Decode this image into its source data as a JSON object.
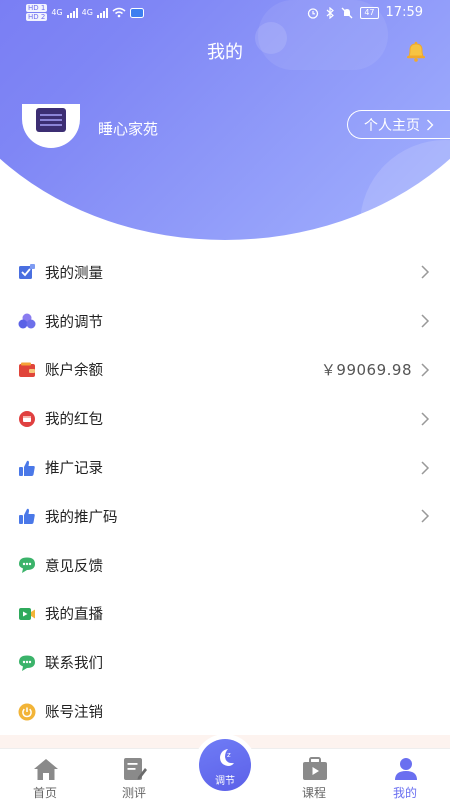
{
  "status_bar": {
    "hd1": "HD 1",
    "hd2": "HD 2",
    "net1": "4G",
    "net2": "4G",
    "battery": "47",
    "time": "17:59"
  },
  "header": {
    "title": "我的",
    "nickname": "睡心家苑",
    "homepage_label": "个人主页"
  },
  "menu": [
    {
      "label": "我的测量",
      "value": "",
      "icon": "measure-icon",
      "color": "#4a6fe0"
    },
    {
      "label": "我的调节",
      "value": "",
      "icon": "adjust-icon",
      "color": "#6b6be0"
    },
    {
      "label": "账户余额",
      "value": "￥99069.98",
      "icon": "wallet-icon",
      "color": "#e0453a"
    },
    {
      "label": "我的红包",
      "value": "",
      "icon": "red-packet-icon",
      "color": "#e04040"
    },
    {
      "label": "推广记录",
      "value": "",
      "icon": "thumb-up-icon",
      "color": "#4a78e8"
    },
    {
      "label": "我的推广码",
      "value": "",
      "icon": "thumb-up-icon",
      "color": "#4a78e8"
    },
    {
      "label": "意见反馈",
      "value": "",
      "icon": "chat-icon",
      "color": "#3bb36a"
    },
    {
      "label": "我的直播",
      "value": "",
      "icon": "video-icon",
      "color": "#2faa5c"
    },
    {
      "label": "联系我们",
      "value": "",
      "icon": "chat-icon",
      "color": "#3bb36a"
    },
    {
      "label": "账号注销",
      "value": "",
      "icon": "power-icon",
      "color": "#f2b437"
    }
  ],
  "tabbar": {
    "home": "首页",
    "evaluate": "测评",
    "adjust": "调节",
    "course": "课程",
    "mine": "我的"
  },
  "colors": {
    "accent": "#6a6ff0",
    "header_gradient_start": "#6f6ef0",
    "header_gradient_end": "#a8b8ff"
  }
}
